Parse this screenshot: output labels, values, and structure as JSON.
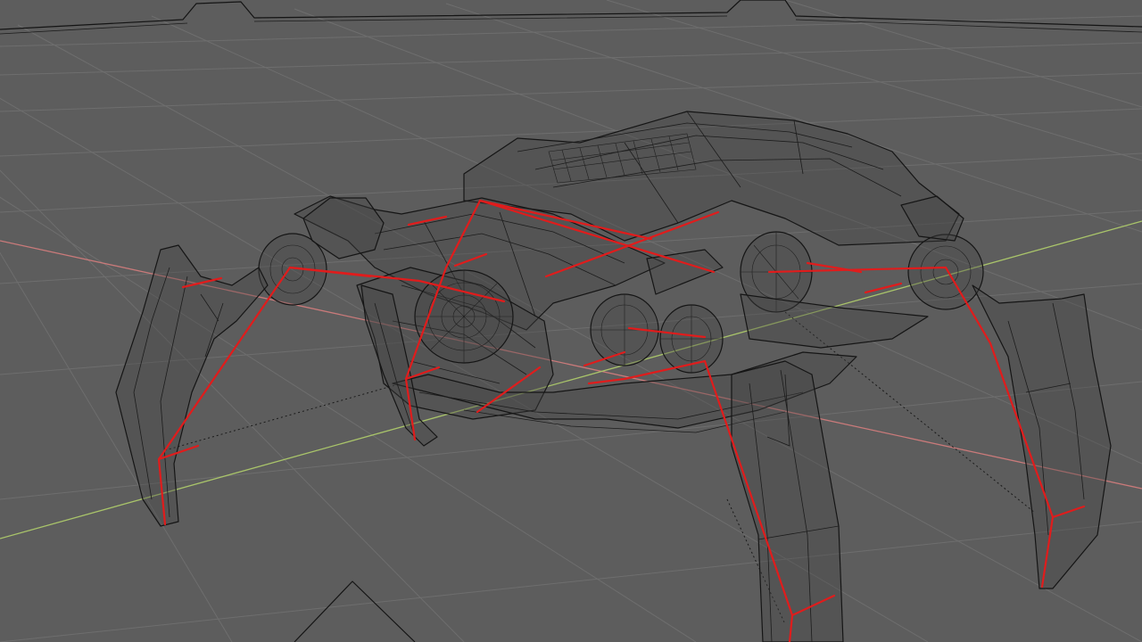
{
  "viewport": {
    "mode": "wireframe",
    "background_color": "#5d5d5d",
    "grid_color": "#6e6e6e",
    "axis_x_color": "#c97a7a",
    "axis_y_color": "#a9c46a",
    "bone_color": "#e01c1c",
    "wire_color": "#141414",
    "object": "spider-mech-robot",
    "armature": "leg-bone-rig"
  }
}
